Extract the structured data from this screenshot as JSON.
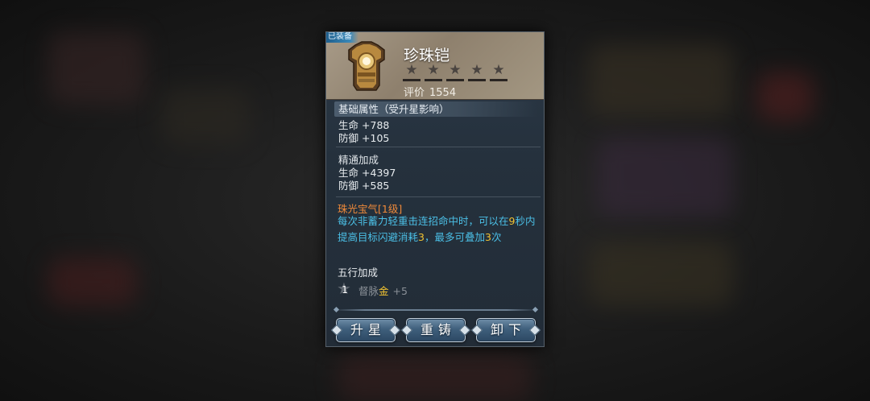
{
  "item": {
    "equipped_tag": "已装备",
    "name": "珍珠铠",
    "stars": [
      "★",
      "★",
      "★",
      "★",
      "★"
    ],
    "stars_filled": 0,
    "rating_label": "评价",
    "rating_value": "1554",
    "icon": "armor-icon"
  },
  "base_attributes": {
    "header": "基础属性（受升星影响）",
    "stats": [
      {
        "label": "生命",
        "value": "+788"
      },
      {
        "label": "防御",
        "value": "+105"
      }
    ]
  },
  "mastery": {
    "title": "精通加成",
    "stats": [
      {
        "label": "生命",
        "value": "+4397"
      },
      {
        "label": "防御",
        "value": "+585"
      }
    ]
  },
  "skill": {
    "name": "珠光宝气[1级]",
    "desc": {
      "p1": "每次非蓄力轻重击连招命中时，可以在",
      "n1": "9",
      "p2": "秒内提高目标闪避消耗",
      "n2": "3",
      "p3": "，最多可叠加",
      "n3": "3",
      "p4": "次"
    }
  },
  "five_elements": {
    "title": "五行加成",
    "level": "1",
    "meridian": "督脉",
    "element": "金",
    "bonus": "+5"
  },
  "buttons": {
    "upgrade": "升星",
    "reforge": "重铸",
    "unequip": "卸下"
  },
  "colors": {
    "skill_name": "#f08a3a",
    "skill_desc": "#4bbfe6",
    "highlight_number": "#f0c232",
    "button_face": "#3f5f7c"
  }
}
